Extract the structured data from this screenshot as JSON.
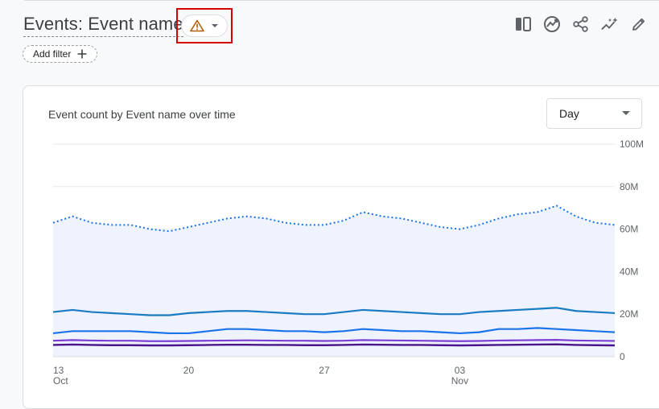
{
  "header": {
    "title": "Events: Event name",
    "add_filter_label": "Add filter",
    "add_filter_icon": "plus-icon",
    "warning_icon": "warning-icon"
  },
  "toolbar": {
    "icons": [
      "compare-columns-icon",
      "insights-icon",
      "share-icon",
      "sparkle-trend-icon",
      "edit-pencil-icon"
    ]
  },
  "card": {
    "title": "Event count by Event name over time",
    "granularity": "Day"
  },
  "colors": {
    "series_top": "#1a73e8",
    "series_dark_blue": "#1967d2",
    "series_purple": "#7b3fd4",
    "series_darkpurple": "#4a148c",
    "area_fill": "#eef3fd",
    "highlight_border": "#d50000",
    "warning": "#b06000"
  },
  "chart_data": {
    "type": "line",
    "title": "Event count by Event name over time",
    "x": [
      "Oct 13",
      "Oct 14",
      "Oct 15",
      "Oct 16",
      "Oct 17",
      "Oct 18",
      "Oct 19",
      "Oct 20",
      "Oct 21",
      "Oct 22",
      "Oct 23",
      "Oct 24",
      "Oct 25",
      "Oct 26",
      "Oct 27",
      "Oct 28",
      "Oct 29",
      "Oct 30",
      "Oct 31",
      "Nov 1",
      "Nov 2",
      "Nov 3",
      "Nov 4",
      "Nov 5",
      "Nov 6",
      "Nov 7",
      "Nov 8",
      "Nov 9",
      "Nov 10",
      "Nov 11"
    ],
    "x_tick_labels": [
      {
        "day": "13",
        "month": "Oct",
        "index": 0
      },
      {
        "day": "20",
        "month": "",
        "index": 7
      },
      {
        "day": "27",
        "month": "",
        "index": 14
      },
      {
        "day": "03",
        "month": "Nov",
        "index": 21
      }
    ],
    "y_tick_labels": [
      "100M",
      "80M",
      "60M",
      "40M",
      "20M",
      "0"
    ],
    "ylim": [
      0,
      100
    ],
    "y_unit": "M",
    "series": [
      {
        "style": "dotted",
        "fill": true,
        "values": [
          63,
          66,
          63,
          62,
          62,
          60,
          59,
          61,
          63,
          65,
          66,
          65,
          63,
          62,
          62,
          64,
          68,
          66,
          65,
          63,
          61,
          60,
          62,
          65,
          67,
          68,
          71,
          66,
          63,
          62
        ]
      },
      {
        "style": "solid",
        "values": [
          21,
          22,
          21,
          20.5,
          20,
          19.5,
          19.5,
          20.5,
          21,
          21.5,
          21.5,
          21,
          20.5,
          20,
          20,
          21,
          22,
          21.5,
          21,
          20.5,
          20,
          20,
          21,
          21.5,
          22,
          22.5,
          23,
          21.5,
          21,
          20.5
        ]
      },
      {
        "style": "solid",
        "values": [
          11,
          12,
          12,
          12,
          12,
          11.5,
          11,
          11,
          12,
          13,
          13,
          12.5,
          12,
          12,
          11.5,
          12,
          13,
          12.5,
          12,
          12,
          11.5,
          11,
          11.5,
          13,
          13,
          13.5,
          13,
          12.5,
          12,
          11.5
        ]
      },
      {
        "style": "solid",
        "values": [
          7.5,
          7.8,
          7.6,
          7.5,
          7.5,
          7.3,
          7.3,
          7.4,
          7.5,
          7.6,
          7.7,
          7.6,
          7.5,
          7.5,
          7.4,
          7.5,
          7.8,
          7.7,
          7.6,
          7.5,
          7.4,
          7.3,
          7.4,
          7.6,
          7.7,
          7.8,
          7.9,
          7.6,
          7.5,
          7.4
        ]
      },
      {
        "style": "solid",
        "values": [
          5.5,
          5.7,
          5.5,
          5.4,
          5.4,
          5.3,
          5.3,
          5.4,
          5.5,
          5.6,
          5.6,
          5.5,
          5.5,
          5.4,
          5.4,
          5.5,
          5.7,
          5.6,
          5.5,
          5.5,
          5.4,
          5.3,
          5.4,
          5.5,
          5.6,
          5.7,
          5.8,
          5.5,
          5.4,
          5.3
        ]
      }
    ],
    "grid": true,
    "legend": "none"
  }
}
